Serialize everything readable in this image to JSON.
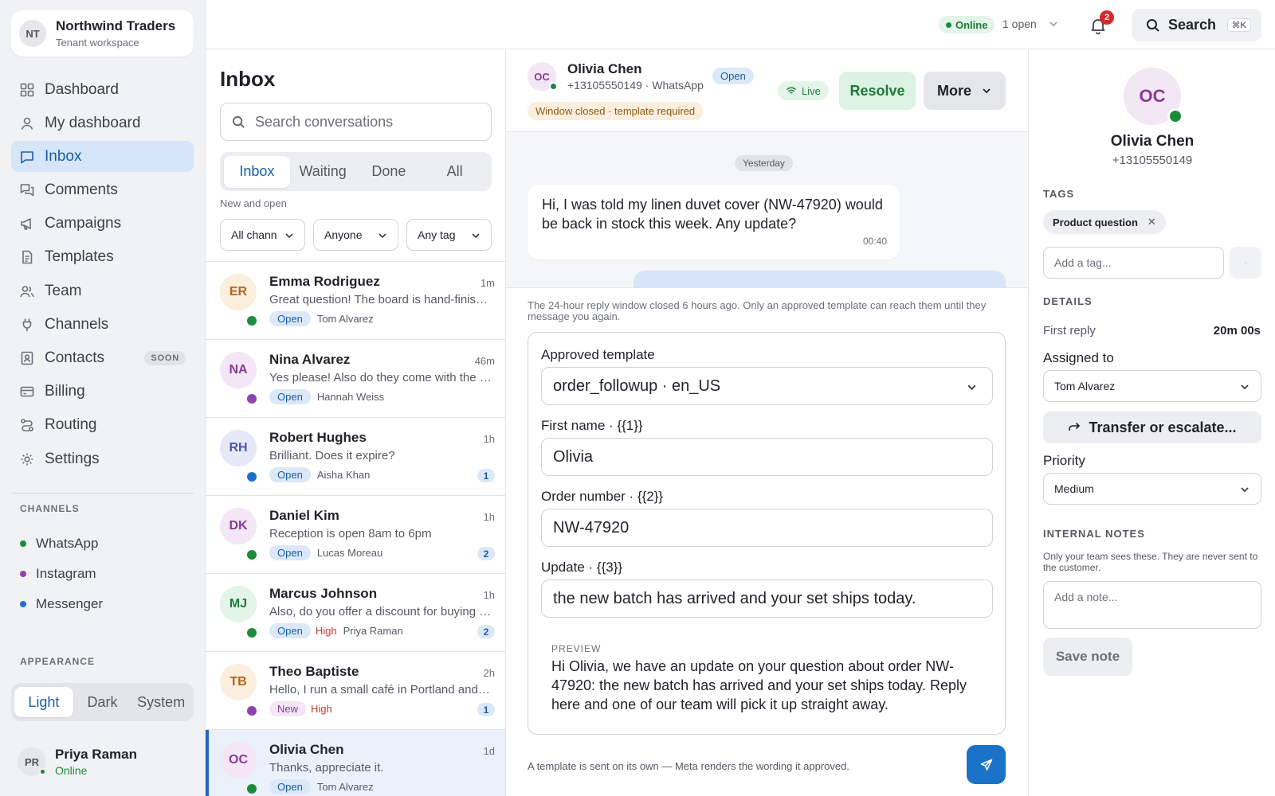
{
  "workspace": {
    "initials": "NT",
    "name": "Northwind Traders",
    "subtitle": "Tenant workspace"
  },
  "nav": [
    {
      "label": "Dashboard",
      "icon": "grid-icon"
    },
    {
      "label": "My dashboard",
      "icon": "user-icon"
    },
    {
      "label": "Inbox",
      "icon": "chat-icon",
      "active": true
    },
    {
      "label": "Comments",
      "icon": "comments-icon"
    },
    {
      "label": "Campaigns",
      "icon": "megaphone-icon"
    },
    {
      "label": "Templates",
      "icon": "document-icon"
    },
    {
      "label": "Team",
      "icon": "team-icon"
    },
    {
      "label": "Channels",
      "icon": "plug-icon"
    },
    {
      "label": "Contacts",
      "icon": "contact-icon",
      "badge": "SOON"
    },
    {
      "label": "Billing",
      "icon": "card-icon"
    },
    {
      "label": "Routing",
      "icon": "route-icon"
    },
    {
      "label": "Settings",
      "icon": "gear-icon"
    }
  ],
  "channels_section": {
    "label": "CHANNELS",
    "items": [
      {
        "label": "WhatsApp",
        "color": "#1e8a3e"
      },
      {
        "label": "Instagram",
        "color": "#8e44ad"
      },
      {
        "label": "Messenger",
        "color": "#1f6fd1"
      }
    ]
  },
  "appearance": {
    "label": "APPEARANCE",
    "options": [
      "Light",
      "Dark",
      "System"
    ],
    "selected": "Light"
  },
  "current_user": {
    "initials": "PR",
    "name": "Priya Raman",
    "status": "Online"
  },
  "topbar": {
    "status": "Online",
    "open_count": "1 open",
    "notifications": "2",
    "search_label": "Search",
    "shortcut": "⌘K"
  },
  "inbox": {
    "title": "Inbox",
    "search_placeholder": "Search conversations",
    "tabs": [
      "Inbox",
      "Waiting",
      "Done",
      "All"
    ],
    "active_tab": "Inbox",
    "subhead": "New and open",
    "filters": [
      "All channels",
      "Anyone",
      "Any tag"
    ],
    "conversations": [
      {
        "initials": "ER",
        "name": "Emma Rodriguez",
        "time": "1m",
        "preview": "Great question! The board is hand-finished in small batches.",
        "status": "Open",
        "priority": "",
        "assignee": "Tom Alvarez",
        "count": "",
        "avatar_bg": "#fbeedd",
        "avatar_fg": "#b0651a",
        "channel_color": "#1e8a3e"
      },
      {
        "initials": "NA",
        "name": "Nina Alvarez",
        "time": "46m",
        "preview": "Yes please! Also do they come with the matching pillowcases?",
        "status": "Open",
        "priority": "",
        "assignee": "Hannah Weiss",
        "count": "",
        "avatar_bg": "#f3e6f5",
        "avatar_fg": "#8a3a99",
        "channel_color": "#8e44ad"
      },
      {
        "initials": "RH",
        "name": "Robert Hughes",
        "time": "1h",
        "preview": "Brilliant. Does it expire?",
        "status": "Open",
        "priority": "",
        "assignee": "Aisha Khan",
        "count": "1",
        "avatar_bg": "#e6e8f8",
        "avatar_fg": "#4a55b0",
        "channel_color": "#1f6fd1"
      },
      {
        "initials": "DK",
        "name": "Daniel Kim",
        "time": "1h",
        "preview": "Reception is open 8am to 6pm",
        "status": "Open",
        "priority": "",
        "assignee": "Lucas Moreau",
        "count": "2",
        "avatar_bg": "#f3e6f5",
        "avatar_fg": "#8a3a99",
        "channel_color": "#1e8a3e"
      },
      {
        "initials": "MJ",
        "name": "Marcus Johnson",
        "time": "1h",
        "preview": "Also, do you offer a discount for buying more than one?",
        "status": "Open",
        "priority": "High",
        "assignee": "Priya Raman",
        "count": "2",
        "avatar_bg": "#e3f4e8",
        "avatar_fg": "#1e7a38",
        "channel_color": "#1e8a3e"
      },
      {
        "initials": "TB",
        "name": "Theo Baptiste",
        "time": "2h",
        "preview": "Hello, I run a small café in Portland and I'd love to stock these.",
        "status": "New",
        "priority": "High",
        "assignee": "",
        "count": "1",
        "avatar_bg": "#fbeedd",
        "avatar_fg": "#b0651a",
        "channel_color": "#8e44ad"
      },
      {
        "initials": "OC",
        "name": "Olivia Chen",
        "time": "1d",
        "preview": "Thanks, appreciate it.",
        "status": "Open",
        "priority": "",
        "assignee": "Tom Alvarez",
        "count": "",
        "avatar_bg": "#f3e6f5",
        "avatar_fg": "#8a3a99",
        "channel_color": "#1e8a3e",
        "selected": true
      }
    ]
  },
  "conversation": {
    "contact_initials": "OC",
    "contact_name": "Olivia Chen",
    "contact_sub": "+13105550149 · WhatsApp",
    "status": "Open",
    "window_notice": "Window closed · template required",
    "live_label": "Live",
    "resolve_label": "Resolve",
    "more_label": "More",
    "day_label": "Yesterday",
    "message_text": "Hi, I was told my linen duvet cover (NW-47920) would be back in stock this week. Any update?",
    "message_time": "00:40",
    "reply_notice": "The 24-hour reply window closed 6 hours ago. Only an approved template can reach them until they message you again.",
    "template_label": "Approved template",
    "template_value": "order_followup · en_US",
    "field1_label": "First name · {{1}}",
    "field1_value": "Olivia",
    "field2_label": "Order number · {{2}}",
    "field2_value": "NW-47920",
    "field3_label": "Update · {{3}}",
    "field3_value": "the new batch has arrived and your set ships today.",
    "preview_label": "PREVIEW",
    "preview_text": "Hi Olivia, we have an update on your question about order NW-47920: the new batch has arrived and your set ships today. Reply here and one of our team will pick it up straight away.",
    "footnote": "A template is sent on its own — Meta renders the wording it approved."
  },
  "details": {
    "initials": "OC",
    "name": "Olivia Chen",
    "phone": "+13105550149",
    "tags_label": "TAGS",
    "tags": [
      "Product question"
    ],
    "tag_placeholder": "Add a tag...",
    "details_label": "DETAILS",
    "first_reply_label": "First reply",
    "first_reply_value": "20m 00s",
    "assigned_label": "Assigned to",
    "assigned_value": "Tom Alvarez",
    "transfer_label": "Transfer or escalate...",
    "priority_label": "Priority",
    "priority_value": "Medium",
    "notes_label": "INTERNAL NOTES",
    "notes_help": "Only your team sees these. They are never sent to the customer.",
    "note_placeholder": "Add a note...",
    "save_note_label": "Save note"
  }
}
